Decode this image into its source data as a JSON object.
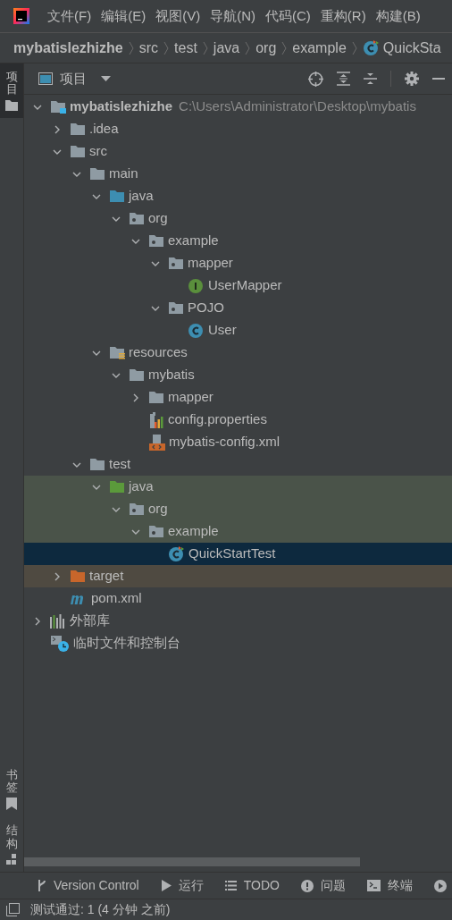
{
  "menu_bar": {
    "items": [
      "文件(F)",
      "编辑(E)",
      "视图(V)",
      "导航(N)",
      "代码(C)",
      "重构(R)",
      "构建(B)"
    ]
  },
  "breadcrumbs": [
    {
      "label": "mybatislezhizhe",
      "kind": "project"
    },
    {
      "label": "src",
      "kind": "folder"
    },
    {
      "label": "test",
      "kind": "folder"
    },
    {
      "label": "java",
      "kind": "folder"
    },
    {
      "label": "org",
      "kind": "folder"
    },
    {
      "label": "example",
      "kind": "folder"
    },
    {
      "label": "QuickSta",
      "kind": "class"
    }
  ],
  "left_strip": [
    {
      "label": "项目",
      "kind": "project",
      "selected": true
    },
    {
      "label": "书签",
      "kind": "bookmarks",
      "selected": false
    },
    {
      "label": "结构",
      "kind": "structure",
      "selected": false
    }
  ],
  "project_panel": {
    "title": "项目"
  },
  "tree": [
    {
      "label": "mybatislezhizhe",
      "path": "C:\\Users\\Administrator\\Desktop\\mybatis",
      "kind": "module",
      "expanded": true,
      "selected": false,
      "children": [
        {
          "label": ".idea",
          "kind": "folder",
          "expanded": false,
          "selected": false
        },
        {
          "label": "src",
          "kind": "folder",
          "expanded": true,
          "selected": false,
          "children": [
            {
              "label": "main",
              "kind": "folder",
              "expanded": true,
              "selected": false,
              "children": [
                {
                  "label": "java",
                  "kind": "source",
                  "expanded": true,
                  "selected": false,
                  "children": [
                    {
                      "label": "org",
                      "kind": "package",
                      "expanded": true,
                      "selected": false,
                      "children": [
                        {
                          "label": "example",
                          "kind": "package",
                          "expanded": true,
                          "selected": false,
                          "children": [
                            {
                              "label": "mapper",
                              "kind": "package",
                              "expanded": true,
                              "selected": false,
                              "children": [
                                {
                                  "label": "UserMapper",
                                  "kind": "interface",
                                  "selected": false
                                }
                              ]
                            },
                            {
                              "label": "POJO",
                              "kind": "package",
                              "expanded": true,
                              "selected": false,
                              "children": [
                                {
                                  "label": "User",
                                  "kind": "class",
                                  "selected": false
                                }
                              ]
                            }
                          ]
                        }
                      ]
                    }
                  ]
                },
                {
                  "label": "resources",
                  "kind": "resources",
                  "expanded": true,
                  "selected": false,
                  "children": [
                    {
                      "label": "mybatis",
                      "kind": "folder",
                      "expanded": true,
                      "selected": false,
                      "children": [
                        {
                          "label": "mapper",
                          "kind": "folder",
                          "expanded": false,
                          "selected": false
                        },
                        {
                          "label": "config.properties",
                          "kind": "properties",
                          "selected": false
                        },
                        {
                          "label": "mybatis-config.xml",
                          "kind": "xml",
                          "selected": false
                        }
                      ]
                    }
                  ]
                }
              ]
            },
            {
              "label": "test",
              "kind": "folder",
              "expanded": true,
              "selected": false,
              "children": [
                {
                  "label": "java",
                  "kind": "test_source",
                  "expanded": true,
                  "selected": false,
                  "color": "#4a5349",
                  "children": [
                    {
                      "label": "org",
                      "kind": "package",
                      "expanded": true,
                      "selected": false,
                      "color": "#4a5349",
                      "children": [
                        {
                          "label": "example",
                          "kind": "package",
                          "expanded": true,
                          "selected": false,
                          "color": "#4a5349",
                          "children": [
                            {
                              "label": "QuickStartTest",
                              "kind": "test_class",
                              "selected": true
                            }
                          ]
                        }
                      ]
                    }
                  ]
                }
              ]
            }
          ]
        },
        {
          "label": "target",
          "kind": "excluded",
          "expanded": false,
          "selected": false,
          "color": "#4f4a41"
        },
        {
          "label": "pom.xml",
          "kind": "maven",
          "selected": false
        }
      ]
    },
    {
      "label": "外部库",
      "kind": "library",
      "expanded": false,
      "selected": false
    },
    {
      "label": "临时文件和控制台",
      "kind": "scratch",
      "selected": false
    }
  ],
  "tool_windows": [
    {
      "label": "Version Control",
      "kind": "vcs"
    },
    {
      "label": "运行",
      "kind": "run"
    },
    {
      "label": "TODO",
      "kind": "todo"
    },
    {
      "label": "问题",
      "kind": "problems"
    },
    {
      "label": "终端",
      "kind": "terminal"
    },
    {
      "kind": "services"
    }
  ],
  "status_bar": {
    "message": "测试通过: 1 (4 分钟 之前)"
  }
}
